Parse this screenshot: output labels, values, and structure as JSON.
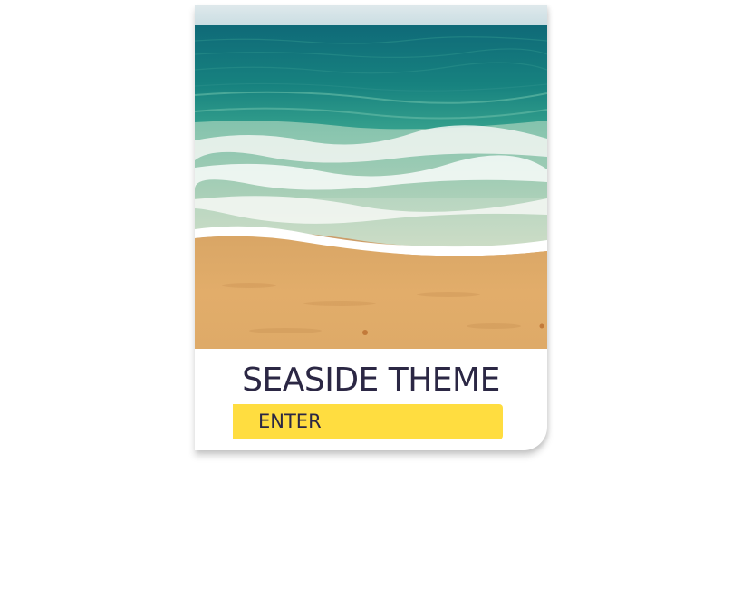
{
  "card": {
    "title": "SEASIDE THEME",
    "enter_label": "ENTER",
    "image_description": "beach-waves-photo"
  },
  "colors": {
    "title_text": "#2b2744",
    "button_bg": "#ffdd40",
    "button_text": "#2b2744",
    "card_bg": "#ffffff"
  }
}
